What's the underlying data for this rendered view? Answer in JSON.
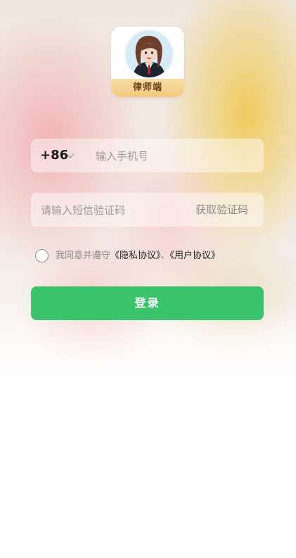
{
  "app": {
    "role_label": "律师端"
  },
  "login": {
    "country_code": "+86",
    "phone_placeholder": "输入手机号",
    "sms_placeholder": "请输入短信验证码",
    "get_code_label": "获取验证码",
    "agreement_prefix": "我同意并遵守",
    "privacy_link": "《隐私协议》",
    "separator": "、",
    "user_link": "《用户协议》",
    "submit_label": "登录"
  },
  "colors": {
    "primary": "#3cc46d",
    "badge": "#f2c97c"
  },
  "icons": {
    "country_dropdown": "chevron-down-icon",
    "avatar": "lawyer-avatar"
  }
}
